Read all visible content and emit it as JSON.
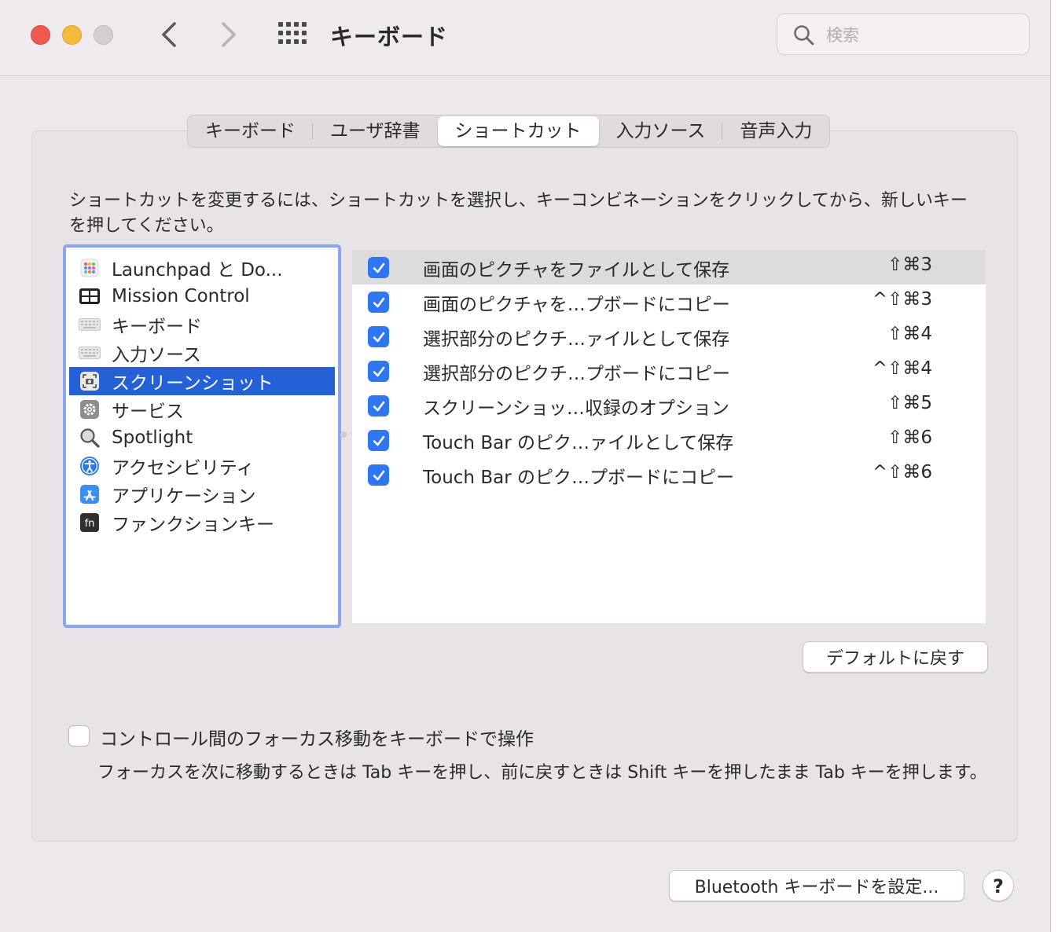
{
  "window": {
    "title": "キーボード",
    "search_placeholder": "検索"
  },
  "tabs": [
    {
      "label": "キーボード",
      "active": false
    },
    {
      "label": "ユーザ辞書",
      "active": false
    },
    {
      "label": "ショートカット",
      "active": true
    },
    {
      "label": "入力ソース",
      "active": false
    },
    {
      "label": "音声入力",
      "active": false
    }
  ],
  "instructions": "ショートカットを変更するには、ショートカットを選択し、キーコンビネーションをクリックしてから、新しいキーを押してください。",
  "sidebar": {
    "items": [
      {
        "label": "Launchpad と Do...",
        "icon": "launchpad-icon"
      },
      {
        "label": "Mission Control",
        "icon": "mission-control-icon"
      },
      {
        "label": "キーボード",
        "icon": "keyboard-icon"
      },
      {
        "label": "入力ソース",
        "icon": "keyboard-icon"
      },
      {
        "label": "スクリーンショット",
        "icon": "screenshot-icon",
        "selected": true
      },
      {
        "label": "サービス",
        "icon": "gear-icon"
      },
      {
        "label": "Spotlight",
        "icon": "magnifier-icon"
      },
      {
        "label": "アクセシビリティ",
        "icon": "accessibility-icon"
      },
      {
        "label": "アプリケーション",
        "icon": "app-store-icon"
      },
      {
        "label": "ファンクションキー",
        "icon": "fn-key-icon"
      }
    ]
  },
  "shortcuts": [
    {
      "label": "画面のピクチャをファイルとして保存",
      "keys": "⇧⌘3",
      "checked": true
    },
    {
      "label": "画面のピクチャを…プボードにコピー",
      "keys": "^⇧⌘3",
      "checked": true
    },
    {
      "label": "選択部分のピクチ…ァイルとして保存",
      "keys": "⇧⌘4",
      "checked": true
    },
    {
      "label": "選択部分のピクチ…プボードにコピー",
      "keys": "^⇧⌘4",
      "checked": true
    },
    {
      "label": "スクリーンショッ…収録のオプション",
      "keys": "⇧⌘5",
      "checked": true
    },
    {
      "label": "Touch Bar のピク…ァイルとして保存",
      "keys": "⇧⌘6",
      "checked": true
    },
    {
      "label": "Touch Bar のピク…プボードにコピー",
      "keys": "^⇧⌘6",
      "checked": true
    }
  ],
  "buttons": {
    "restore_defaults": "デフォルトに戻す",
    "bluetooth": "Bluetooth キーボードを設定...",
    "help": "?"
  },
  "focus_option": {
    "label": "コントロール間のフォーカス移動をキーボードで操作",
    "checked": false,
    "description": "フォーカスを次に移動するときは Tab キーを押し、前に戻すときは Shift キーを押したまま Tab キーを押します。"
  },
  "colors": {
    "accent": "#2461d7",
    "checkbox": "#2f76f2",
    "sidebar_border": "#8aa6ec"
  }
}
